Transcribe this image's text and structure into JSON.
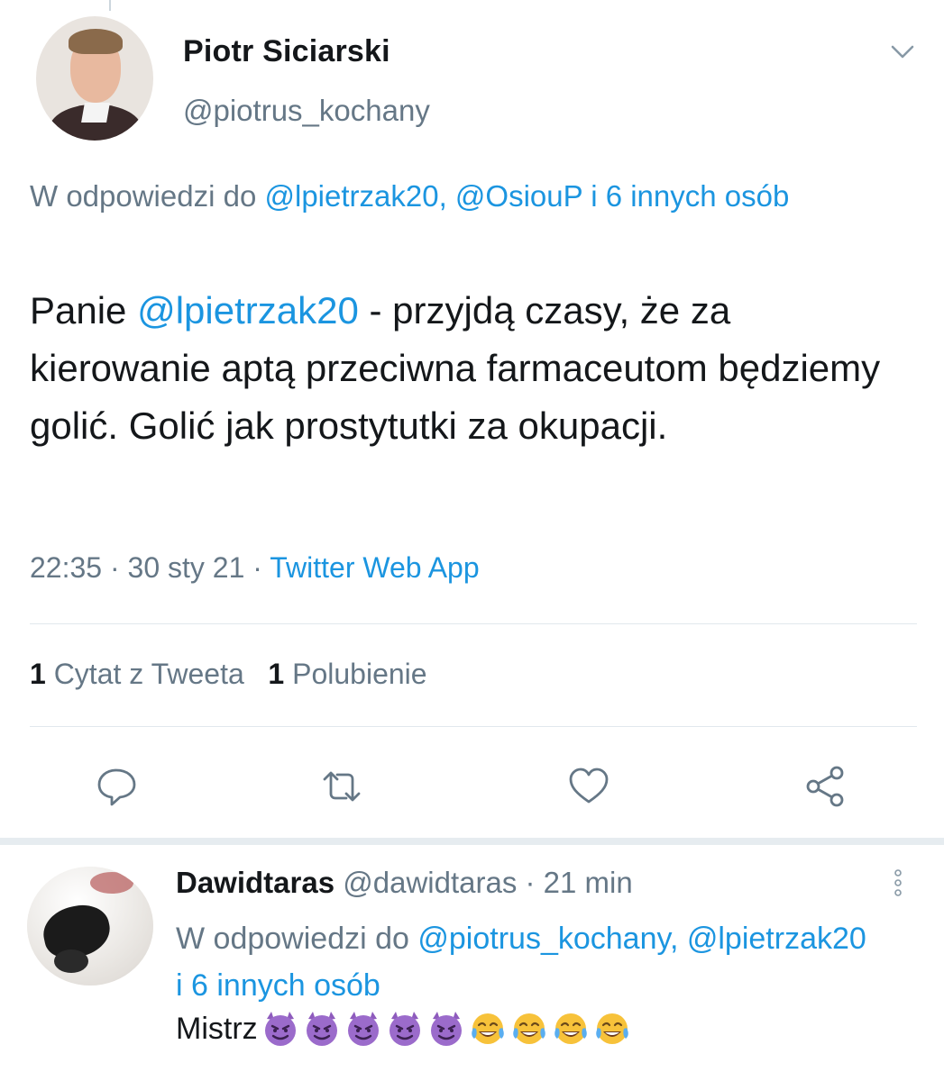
{
  "tweet": {
    "author": {
      "name": "Piotr Siciarski",
      "handle": "@piotrus_kochany"
    },
    "reply_to": {
      "prefix": "W odpowiedzi do ",
      "mentions": "@lpietrzak20, @OsiouP i 6 innych osób"
    },
    "text": {
      "before": "Panie ",
      "mention": "@lpietrzak20",
      "after": " - przyjdą czasy, że za kierowanie aptą przeciwna farmaceutom będziemy golić. Golić jak prostytutki za okupacji."
    },
    "time": "22:35",
    "date": "30 sty 21",
    "source": "Twitter Web App",
    "stats": {
      "quote_count": "1",
      "quote_label": "Cytat z Tweeta",
      "like_count": "1",
      "like_label": "Polubienie"
    }
  },
  "reply": {
    "name": "Dawidtaras",
    "handle": "@dawidtaras",
    "time": "21 min",
    "reply_to": {
      "prefix": "W odpowiedzi do ",
      "mentions": "@piotrus_kochany, @lpietrzak20 i 6 innych osób"
    },
    "text": "Mistrz",
    "emojis": [
      "smiling-imp",
      "smiling-imp",
      "smiling-imp",
      "smiling-imp",
      "smiling-imp",
      "joy",
      "joy",
      "joy",
      "joy"
    ]
  },
  "colors": {
    "link": "#1b95e0",
    "secondary": "#657786",
    "primary_text": "#14171a",
    "divider": "#e1e8ed"
  },
  "icons": [
    "chevron-down-icon",
    "reply-icon",
    "retweet-icon",
    "like-icon",
    "share-icon",
    "more-vertical-icon"
  ]
}
